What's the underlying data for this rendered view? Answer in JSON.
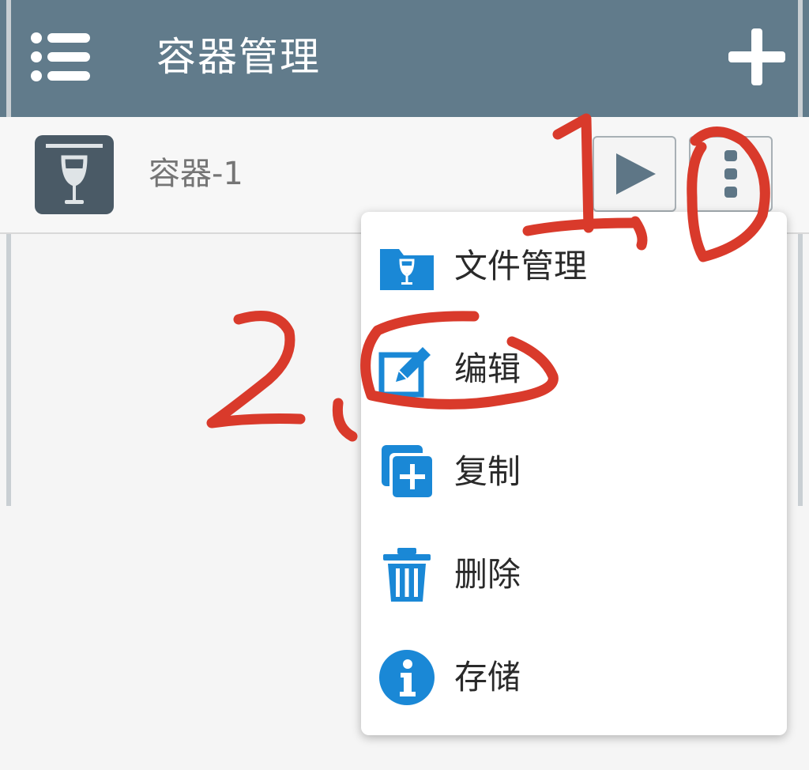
{
  "app": {
    "title": "容器管理"
  },
  "toolbar": {
    "menu_icon": "list-menu-icon",
    "add_icon": "plus-icon"
  },
  "containers": [
    {
      "name": "容器-1",
      "icon": "wine-glass-box-icon"
    }
  ],
  "context_menu": {
    "items": [
      {
        "label": "文件管理",
        "icon": "folder-wine-icon"
      },
      {
        "label": "编辑",
        "icon": "edit-pencil-icon"
      },
      {
        "label": "复制",
        "icon": "copy-plus-icon"
      },
      {
        "label": "删除",
        "icon": "trash-icon"
      },
      {
        "label": "存储",
        "icon": "info-icon"
      }
    ]
  },
  "annotations": {
    "step1": "1.",
    "step2": "2.",
    "color": "#d93a2b"
  },
  "colors": {
    "toolbar": "#617b8b",
    "accent": "#1a88d6",
    "icon_dark": "#4a5a66"
  }
}
